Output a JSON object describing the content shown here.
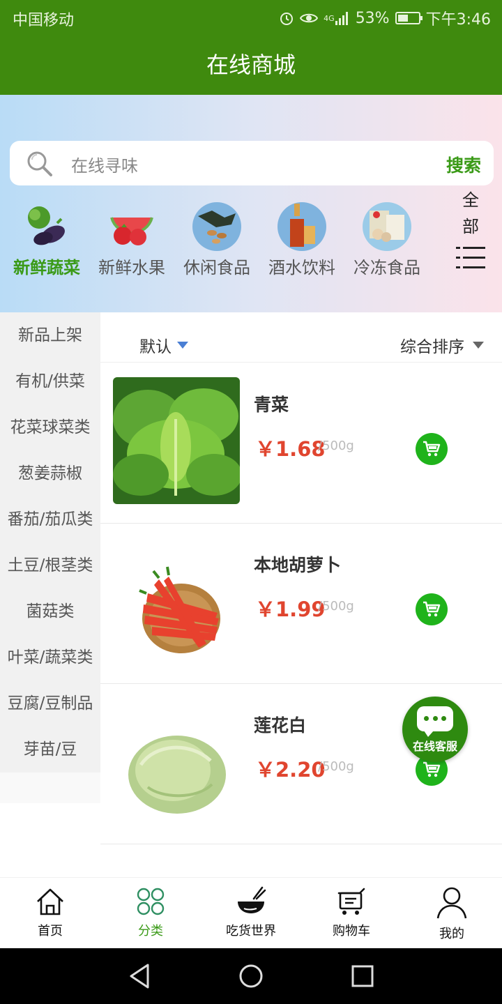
{
  "status_bar": {
    "carrier": "中国移动",
    "network": "4G",
    "battery": "53%",
    "battery_level": 0.53,
    "time": "下午3:46"
  },
  "header": {
    "title": "在线商城"
  },
  "search": {
    "placeholder": "在线寻味",
    "button": "搜索"
  },
  "categories": [
    {
      "label": "新鲜蔬菜",
      "icon": "vegetables-icon",
      "active": true
    },
    {
      "label": "新鲜水果",
      "icon": "fruits-icon",
      "active": false
    },
    {
      "label": "休闲食品",
      "icon": "snacks-icon",
      "active": false
    },
    {
      "label": "酒水饮料",
      "icon": "drinks-icon",
      "active": false
    },
    {
      "label": "冷冻食品",
      "icon": "frozen-food-icon",
      "active": false
    }
  ],
  "all_toggle": {
    "label_line1": "全",
    "label_line2": "部"
  },
  "sidebar": {
    "items": [
      "新品上架",
      "有机/供菜",
      "花菜球菜类",
      "葱姜蒜椒",
      "番茄/茄瓜类",
      "土豆/根茎类",
      "菌菇类",
      "叶菜/蔬菜类",
      "豆腐/豆制品",
      "芽苗/豆"
    ]
  },
  "sort": {
    "default": "默认",
    "overall": "综合排序"
  },
  "products": [
    {
      "name": "青菜",
      "price": "￥1.68",
      "unit": "/500g",
      "image": "bok-choy-image"
    },
    {
      "name": "本地胡萝卜",
      "price": "￥1.99",
      "unit": "/500g",
      "image": "carrot-image"
    },
    {
      "name": "莲花白",
      "price": "￥2.20",
      "unit": "/500g",
      "image": "cabbage-image"
    }
  ],
  "floating_service": {
    "label": "在线客服"
  },
  "tabbar": {
    "items": [
      {
        "label": "首页",
        "icon": "home-icon",
        "active": false
      },
      {
        "label": "分类",
        "icon": "category-icon",
        "active": true
      },
      {
        "label": "吃货世界",
        "icon": "bowl-icon",
        "active": false
      },
      {
        "label": "购物车",
        "icon": "cart-icon",
        "active": false
      },
      {
        "label": "我的",
        "icon": "user-icon",
        "active": false
      }
    ]
  },
  "colors": {
    "primary": "#3f8a0e",
    "accent_green": "#3a9a17",
    "price_red": "#e0452f",
    "cart_green": "#1fb31b"
  }
}
